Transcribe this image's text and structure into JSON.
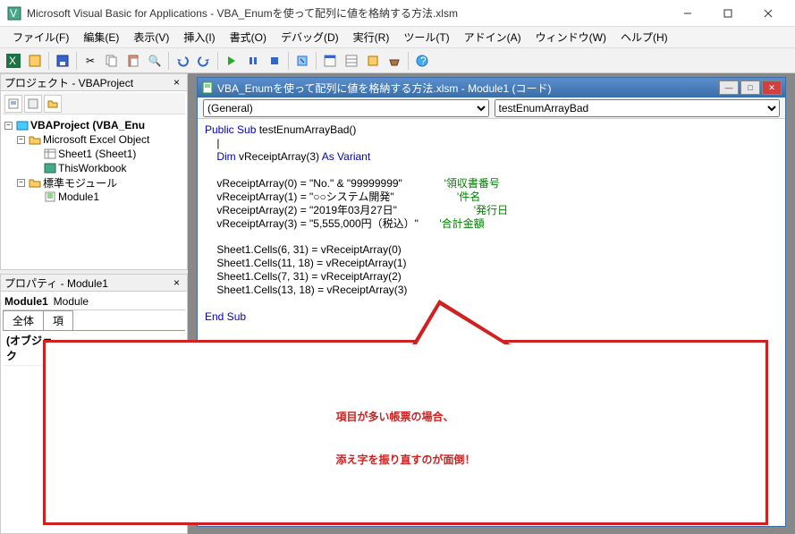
{
  "window": {
    "title": "Microsoft Visual Basic for Applications - VBA_Enumを使って配列に値を格納する方法.xlsm"
  },
  "menu": {
    "file": "ファイル(F)",
    "edit": "編集(E)",
    "view": "表示(V)",
    "insert": "挿入(I)",
    "format": "書式(O)",
    "debug": "デバッグ(D)",
    "run": "実行(R)",
    "tools": "ツール(T)",
    "addins": "アドイン(A)",
    "window": "ウィンドウ(W)",
    "help": "ヘルプ(H)"
  },
  "project_panel": {
    "title": "プロジェクト - VBAProject",
    "root": "VBAProject (VBA_Enu",
    "excel_objects": "Microsoft Excel Object",
    "sheet1": "Sheet1 (Sheet1)",
    "thisworkbook": "ThisWorkbook",
    "std_modules": "標準モジュール",
    "module1": "Module1"
  },
  "properties_panel": {
    "title": "プロパティ - Module1",
    "object_name": "Module1",
    "object_type": "Module",
    "tab_all": "全体",
    "tab_cat": "項",
    "row1_key": "(オブジェク"
  },
  "code_window": {
    "title": "VBA_Enumを使って配列に値を格納する方法.xlsm - Module1 (コード)",
    "dropdown_left": "(General)",
    "dropdown_right": "testEnumArrayBad",
    "lines": {
      "l1a": "Public Sub",
      "l1b": " testEnumArrayBad()",
      "l2": "    |",
      "l3a": "    Dim",
      "l3b": " vReceiptArray(3) ",
      "l3c": "As Variant",
      "l4": "",
      "l5": "    vReceiptArray(0) = \"No.\" & \"99999999\"",
      "c5": "'領収書番号",
      "l6": "    vReceiptArray(1) = \"○○システム開発\"",
      "c6": "'件名",
      "l7": "    vReceiptArray(2) = \"2019年03月27日\"",
      "c7": "'発行日",
      "l8": "    vReceiptArray(3) = \"5,555,000円（税込）\"",
      "c8": "'合計金額",
      "l9": "",
      "l10": "    Sheet1.Cells(6, 31) = vReceiptArray(0)",
      "l11": "    Sheet1.Cells(11, 18) = vReceiptArray(1)",
      "l12": "    Sheet1.Cells(7, 31) = vReceiptArray(2)",
      "l13": "    Sheet1.Cells(13, 18) = vReceiptArray(3)",
      "l14": "",
      "l15": "End Sub"
    }
  },
  "callout": {
    "line1": "項目が多い帳票の場合、",
    "line2": "添え字を振り直すのが面倒！"
  }
}
